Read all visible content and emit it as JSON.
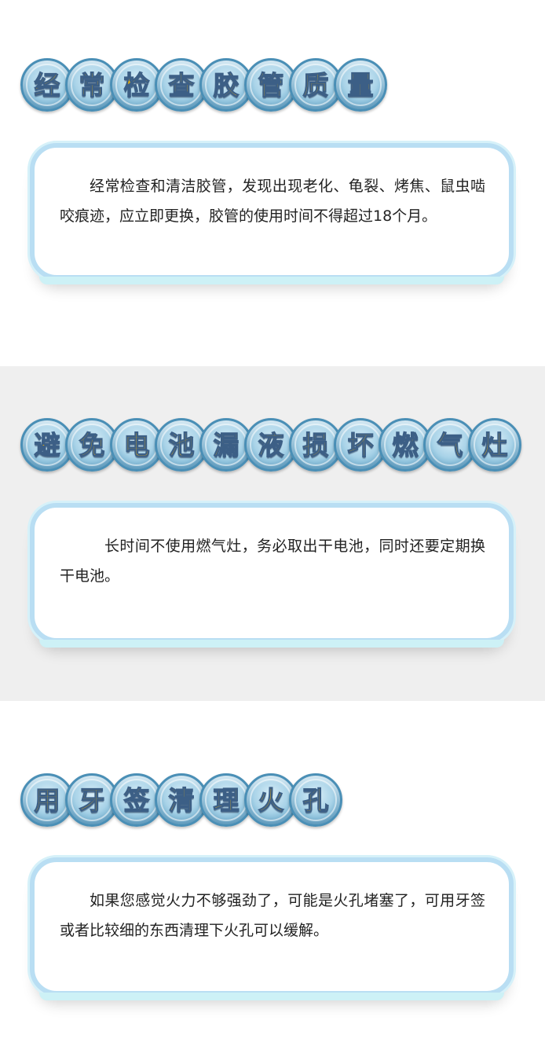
{
  "sections": [
    {
      "title_chars": [
        "经",
        "常",
        "检",
        "查",
        "胶",
        "管",
        "质",
        "量"
      ],
      "body": "经常检查和清洁胶管，发现出现老化、龟裂、烤焦、鼠虫啮咬痕迹，应立即更换，胶管的使用时间不得超过18个月。"
    },
    {
      "title_chars": [
        "避",
        "免",
        "电",
        "池",
        "漏",
        "液",
        "损",
        "坏",
        "燃",
        "气",
        "灶"
      ],
      "body": "长时间不使用燃气灶，务必取出干电池，同时还要定期换干电池。"
    },
    {
      "title_chars": [
        "用",
        "牙",
        "签",
        "清",
        "理",
        "火",
        "孔"
      ],
      "body": "如果您感觉火力不够强劲了，可能是火孔堵塞了，可用牙签或者比较细的东西清理下火孔可以缓解。"
    }
  ],
  "colors": {
    "title_text": "#f7b400",
    "bubble": "#6fb0d1",
    "card_border": "#b9def3",
    "section2_bg": "#efefef"
  }
}
